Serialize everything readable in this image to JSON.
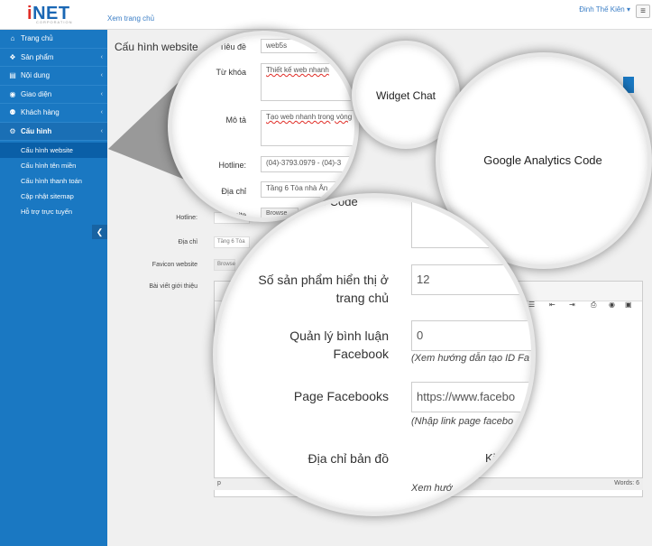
{
  "header": {
    "logo_text": "iNET",
    "logo_sub": "CORPORATION",
    "view_site": "Xem trang chủ",
    "user_name": "Đinh Thế Kiên ▾",
    "menu_icon": "≡"
  },
  "sidebar": {
    "items": [
      {
        "label": "Trang chủ",
        "icon": "home-icon",
        "glyph": "⌂",
        "chev": ""
      },
      {
        "label": "Sản phẩm",
        "icon": "cubes-icon",
        "glyph": "❖",
        "chev": "‹"
      },
      {
        "label": "Nội dung",
        "icon": "document-icon",
        "glyph": "▤",
        "chev": "‹"
      },
      {
        "label": "Giao diện",
        "icon": "eye-icon",
        "glyph": "◉",
        "chev": "‹"
      },
      {
        "label": "Khách hàng",
        "icon": "users-icon",
        "glyph": "⚉",
        "chev": "‹"
      },
      {
        "label": "Cấu hình",
        "icon": "gear-icon",
        "glyph": "⚙",
        "chev": "‹"
      }
    ],
    "submenu": [
      {
        "label": "Cấu hình website"
      },
      {
        "label": "Cấu hình tên miền"
      },
      {
        "label": "Cấu hình thanh toán"
      },
      {
        "label": "Cập nhật sitemap"
      },
      {
        "label": "Hỗ trợ trực tuyến"
      }
    ],
    "collapse_glyph": "❮"
  },
  "content": {
    "page_title": "Cấu hình website",
    "rows": {
      "hotline": "Hotline:",
      "address": "Địa chỉ",
      "favicon": "Favicon website",
      "intro": "Bài viết giới thiệu"
    },
    "address_value": "Tầng 6 Tòa",
    "browse": "Browse",
    "editor_path": "p",
    "editor_words": "Words: 6"
  },
  "lens_form": {
    "title_label": "Tiêu đề",
    "title_value": "web5s",
    "keywords_label": "Từ khóa",
    "keywords_value": "Thiết kế web nhanh",
    "description_label": "Mô tả",
    "description_value": "Tạo web nhanh trong vòng",
    "hotline_label": "Hotline:",
    "hotline_value": "(04)-3793.0979 - (04)-3",
    "address_label": "Địa chỉ",
    "address_value": "Tầng 6 Tòa nhà Ân",
    "favicon_label": "Favicon website",
    "browse_label": "Browse"
  },
  "lens_widget": {
    "label": "Widget Chat"
  },
  "lens_analytics": {
    "label": "Google Analytics Code"
  },
  "lens_main": {
    "analytics_label": "ytics Code",
    "products_label": "Số sản phẩm hiển thị ở trang chủ",
    "products_value": "12",
    "comments_label": "Quản lý bình luận Facebook",
    "comments_value": "0",
    "comments_hint": "(Xem hướng dẫn tạo ID Fa",
    "page_label": "Page Facebooks",
    "page_value": "https://www.facebo",
    "page_hint": "(Nhập link page facebo",
    "map_label": "Địa chỉ bản đồ",
    "map_hint": "Xem hướ",
    "map_value_partial": "Ki"
  }
}
